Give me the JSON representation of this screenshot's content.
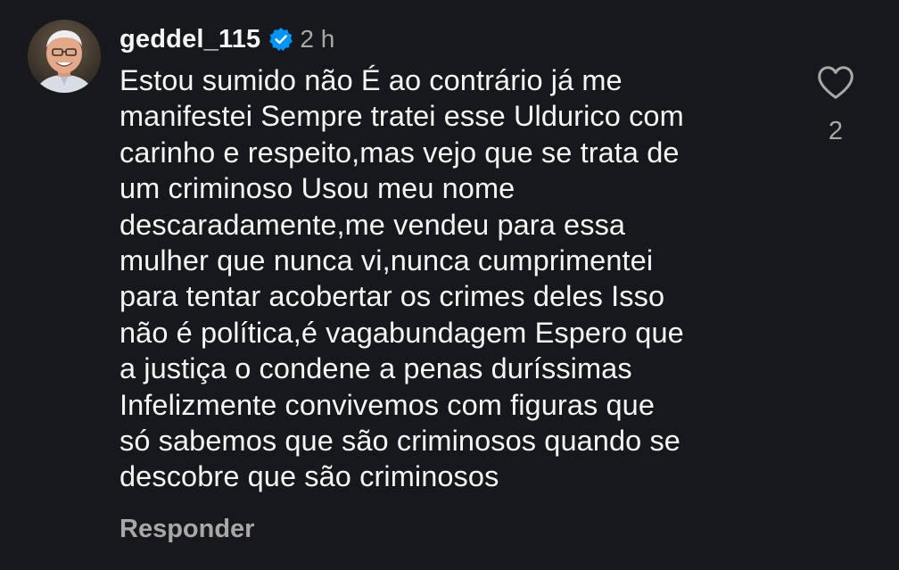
{
  "comment": {
    "username": "geddel_115",
    "verified": true,
    "timestamp": "2 h",
    "text": "Estou sumido não É ao contrário já me\nmanifestei Sempre tratei esse Uldurico com\ncarinho e respeito,mas vejo que se trata de\num criminoso Usou meu nome\ndescaradamente,me vendeu para essa\nmulher que nunca vi,nunca cumprimentei\npara tentar acobertar os crimes deles Isso\nnão é política,é vagabundagem Espero que\na justiça o condene a penas duríssimas\nInfelizmente convivemos com figuras que\nsó sabemos que são criminosos quando se\ndescobre que são criminosos",
    "reply_label": "Responder",
    "like_count": "2"
  },
  "icons": {
    "verified": "verified-badge-icon",
    "like": "heart-outline-icon"
  },
  "colors": {
    "background": "#16181c",
    "primary_text": "#f3f5f7",
    "secondary_text": "#a8a8a8",
    "verified_blue": "#0095f6"
  }
}
